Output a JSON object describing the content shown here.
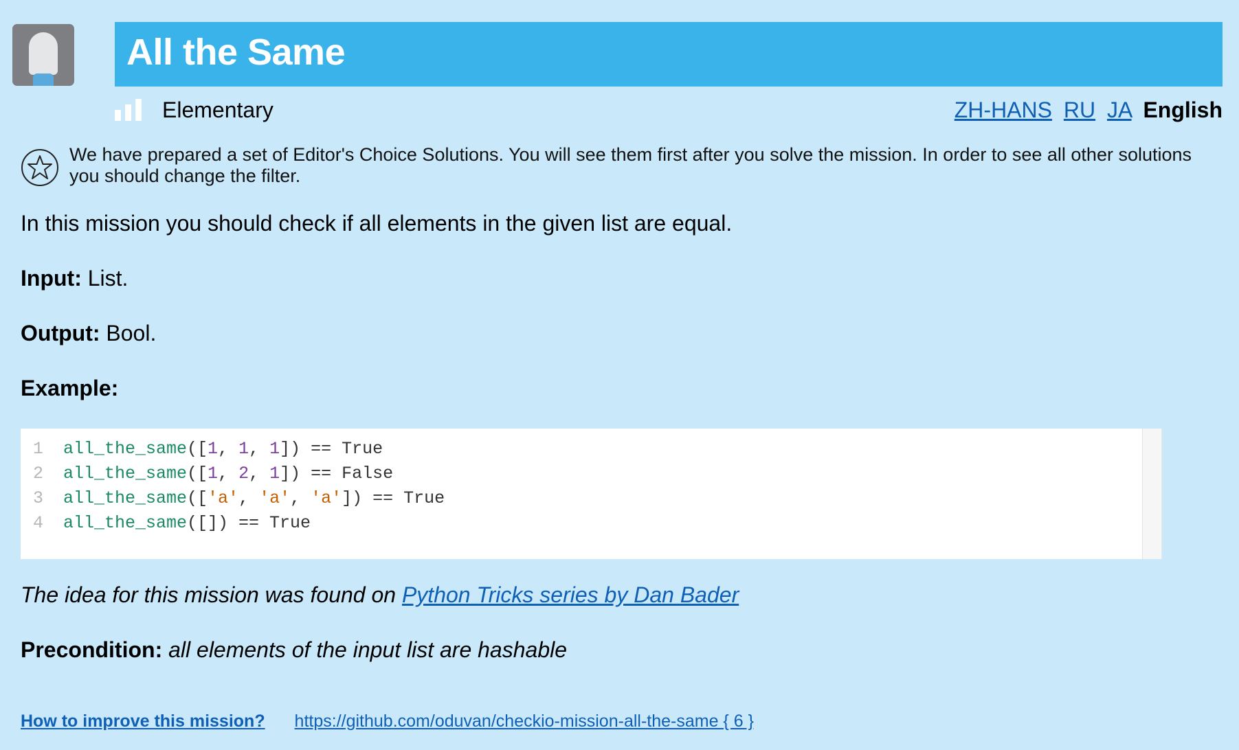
{
  "header": {
    "title": "All the Same",
    "level": "Elementary",
    "languages": [
      "ZH-HANS",
      "RU",
      "JA"
    ],
    "current_language": "English"
  },
  "notice": {
    "text": "We have prepared a set of Editor's Choice Solutions. You will see them first after you solve the mission. In order to see all other solutions you should change the filter."
  },
  "description": {
    "intro": "In this mission you should check if all elements in the given list are equal.",
    "input_label": "Input:",
    "input_value": " List.",
    "output_label": "Output:",
    "output_value": " Bool.",
    "example_label": "Example:"
  },
  "code": {
    "line_numbers": [
      "1",
      "2",
      "3",
      "4"
    ]
  },
  "idea": {
    "text": "The idea for this mission was found on ",
    "link": "Python Tricks series by Dan Bader"
  },
  "precondition": {
    "label": "Precondition:",
    "value": "all elements of the input list are hashable"
  },
  "footer": {
    "improve_link": "How to improve this mission?",
    "repo_link": "https://github.com/oduvan/checkio-mission-all-the-same { 6 }"
  },
  "colors": {
    "background": "#c9e9fb",
    "title_bar": "#3ab3eb",
    "link": "#0f5fb4"
  }
}
